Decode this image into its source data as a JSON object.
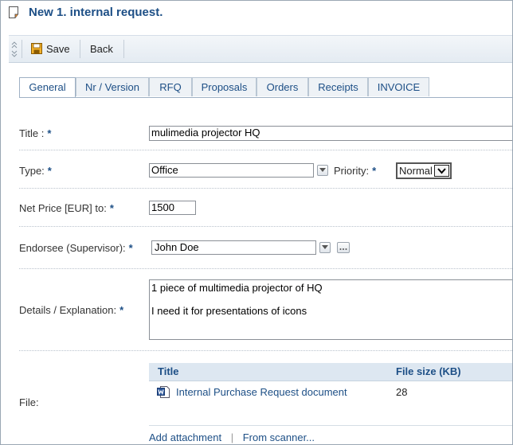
{
  "window": {
    "title": "New 1. internal request."
  },
  "toolbar": {
    "save_label": "Save",
    "back_label": "Back"
  },
  "tabs": [
    {
      "label": "General",
      "active": true
    },
    {
      "label": "Nr / Version"
    },
    {
      "label": "RFQ"
    },
    {
      "label": "Proposals"
    },
    {
      "label": "Orders"
    },
    {
      "label": "Receipts"
    },
    {
      "label": "INVOICE"
    }
  ],
  "form": {
    "required_mark": "*",
    "title_label": "Title :",
    "title_value": "mulimedia projector HQ",
    "type_label": "Type:",
    "type_value": "Office",
    "priority_label": "Priority:",
    "priority_value": "Normal",
    "price_label": "Net Price [EUR] to:",
    "price_value": "1500",
    "endorsee_label": "Endorsee (Supervisor):",
    "endorsee_value": "John Doe",
    "details_label": "Details / Explanation:",
    "details_line1": "1 piece of multimedia projector of HQ",
    "details_line2": "I need it for presentations of icons",
    "file_label": "File:"
  },
  "files": {
    "col_title": "Title",
    "col_size": "File size (KB)",
    "rows": [
      {
        "title": "Internal Purchase Request document",
        "size": "28",
        "icon": "word-document-icon"
      }
    ],
    "add_attachment": "Add attachment",
    "separator": "|",
    "from_scanner": "From scanner..."
  },
  "colors": {
    "accent": "#1d4f86",
    "toolbar_bg": "#e8eef4",
    "table_header_bg": "#dde7f1"
  }
}
